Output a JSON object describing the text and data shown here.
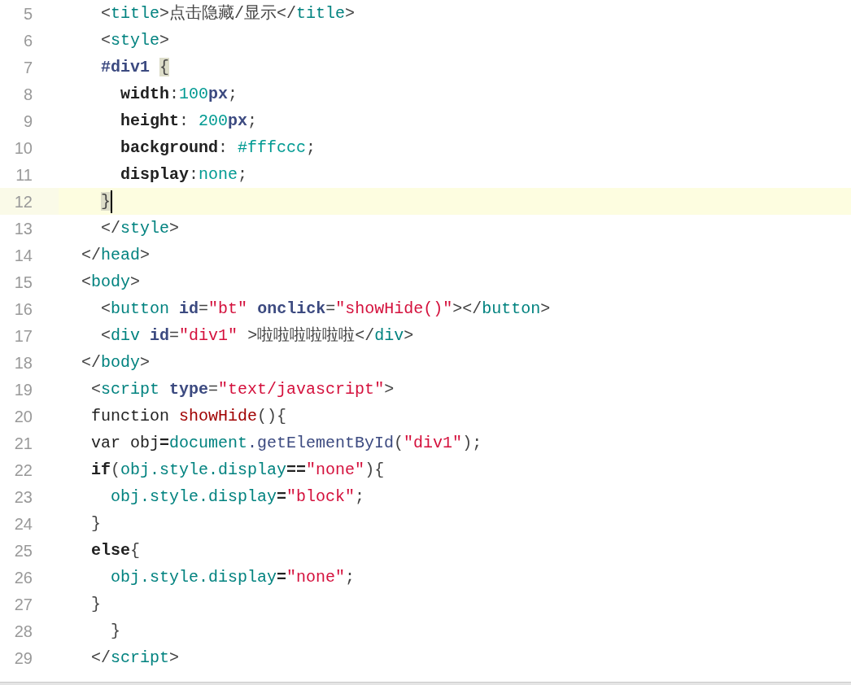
{
  "editor": {
    "lines": [
      {
        "number": "5",
        "current": false,
        "tokens": [
          {
            "text": "      <",
            "kind": "punct"
          },
          {
            "text": "title",
            "kind": "tag"
          },
          {
            "text": ">点击隐藏/显示</",
            "kind": "punct"
          },
          {
            "text": "title",
            "kind": "tag"
          },
          {
            "text": ">",
            "kind": "punct"
          }
        ]
      },
      {
        "number": "6",
        "current": false,
        "tokens": [
          {
            "text": "      <",
            "kind": "punct"
          },
          {
            "text": "style",
            "kind": "tag"
          },
          {
            "text": ">",
            "kind": "punct"
          }
        ]
      },
      {
        "number": "7",
        "current": false,
        "tokens": [
          {
            "text": "      #div1 ",
            "kind": "selector"
          },
          {
            "text": "{",
            "kind": "brace-match"
          }
        ]
      },
      {
        "number": "8",
        "current": false,
        "tokens": [
          {
            "text": "        width",
            "kind": "property"
          },
          {
            "text": ":",
            "kind": "punct"
          },
          {
            "text": "100",
            "kind": "number"
          },
          {
            "text": "px",
            "kind": "unit"
          },
          {
            "text": ";",
            "kind": "punct"
          }
        ]
      },
      {
        "number": "9",
        "current": false,
        "tokens": [
          {
            "text": "        height",
            "kind": "property"
          },
          {
            "text": ": ",
            "kind": "punct"
          },
          {
            "text": "200",
            "kind": "number"
          },
          {
            "text": "px",
            "kind": "unit"
          },
          {
            "text": ";",
            "kind": "punct"
          }
        ]
      },
      {
        "number": "10",
        "current": false,
        "tokens": [
          {
            "text": "        background",
            "kind": "property"
          },
          {
            "text": ": ",
            "kind": "punct"
          },
          {
            "text": "#fffccc",
            "kind": "number"
          },
          {
            "text": ";",
            "kind": "punct"
          }
        ]
      },
      {
        "number": "11",
        "current": false,
        "tokens": [
          {
            "text": "        display",
            "kind": "property"
          },
          {
            "text": ":",
            "kind": "punct"
          },
          {
            "text": "none",
            "kind": "number"
          },
          {
            "text": ";",
            "kind": "punct"
          }
        ]
      },
      {
        "number": "12",
        "current": true,
        "tokens": [
          {
            "text": "      }",
            "kind": "brace-match"
          }
        ]
      },
      {
        "number": "13",
        "current": false,
        "tokens": [
          {
            "text": "      </",
            "kind": "punct"
          },
          {
            "text": "style",
            "kind": "tag"
          },
          {
            "text": ">",
            "kind": "punct"
          }
        ]
      },
      {
        "number": "14",
        "current": false,
        "tokens": [
          {
            "text": "    </",
            "kind": "punct"
          },
          {
            "text": "head",
            "kind": "tag"
          },
          {
            "text": ">",
            "kind": "punct"
          }
        ]
      },
      {
        "number": "15",
        "current": false,
        "tokens": [
          {
            "text": "    <",
            "kind": "punct"
          },
          {
            "text": "body",
            "kind": "tag"
          },
          {
            "text": ">",
            "kind": "punct"
          }
        ]
      },
      {
        "number": "16",
        "current": false,
        "tokens": [
          {
            "text": "      <",
            "kind": "punct"
          },
          {
            "text": "button ",
            "kind": "tag"
          },
          {
            "text": "id",
            "kind": "attr"
          },
          {
            "text": "=",
            "kind": "punct"
          },
          {
            "text": "\"bt\" ",
            "kind": "string"
          },
          {
            "text": "onclick",
            "kind": "attr"
          },
          {
            "text": "=",
            "kind": "punct"
          },
          {
            "text": "\"showHide()\"",
            "kind": "string"
          },
          {
            "text": "></",
            "kind": "punct"
          },
          {
            "text": "button",
            "kind": "tag"
          },
          {
            "text": ">",
            "kind": "punct"
          }
        ]
      },
      {
        "number": "17",
        "current": false,
        "tokens": [
          {
            "text": "      <",
            "kind": "punct"
          },
          {
            "text": "div ",
            "kind": "tag"
          },
          {
            "text": "id",
            "kind": "attr"
          },
          {
            "text": "=",
            "kind": "punct"
          },
          {
            "text": "\"div1\"",
            "kind": "string"
          },
          {
            "text": " >啦啦啦啦啦啦</",
            "kind": "punct"
          },
          {
            "text": "div",
            "kind": "tag"
          },
          {
            "text": ">",
            "kind": "punct"
          }
        ]
      },
      {
        "number": "18",
        "current": false,
        "tokens": [
          {
            "text": "    </",
            "kind": "punct"
          },
          {
            "text": "body",
            "kind": "tag"
          },
          {
            "text": ">",
            "kind": "punct"
          }
        ]
      },
      {
        "number": "19",
        "current": false,
        "tokens": [
          {
            "text": "     <",
            "kind": "punct"
          },
          {
            "text": "script ",
            "kind": "tag"
          },
          {
            "text": "type",
            "kind": "attr"
          },
          {
            "text": "=",
            "kind": "punct"
          },
          {
            "text": "\"text/javascript\"",
            "kind": "string"
          },
          {
            "text": ">",
            "kind": "punct"
          }
        ]
      },
      {
        "number": "20",
        "current": false,
        "tokens": [
          {
            "text": "     function ",
            "kind": "plain"
          },
          {
            "text": "showHide",
            "kind": "funcname"
          },
          {
            "text": "(){",
            "kind": "punct"
          }
        ]
      },
      {
        "number": "21",
        "current": false,
        "tokens": [
          {
            "text": "     var obj",
            "kind": "plain"
          },
          {
            "text": "=",
            "kind": "keyword"
          },
          {
            "text": "document",
            "kind": "tag"
          },
          {
            "text": ".getElementById",
            "kind": "attr-light"
          },
          {
            "text": "(",
            "kind": "punct"
          },
          {
            "text": "\"div1\"",
            "kind": "string"
          },
          {
            "text": ");",
            "kind": "punct"
          }
        ]
      },
      {
        "number": "22",
        "current": false,
        "tokens": [
          {
            "text": "     if",
            "kind": "keyword"
          },
          {
            "text": "(",
            "kind": "punct"
          },
          {
            "text": "obj.style.display",
            "kind": "tag"
          },
          {
            "text": "==",
            "kind": "keyword"
          },
          {
            "text": "\"none\"",
            "kind": "string"
          },
          {
            "text": "){",
            "kind": "punct"
          }
        ]
      },
      {
        "number": "23",
        "current": false,
        "tokens": [
          {
            "text": "       obj.style.display",
            "kind": "tag"
          },
          {
            "text": "=",
            "kind": "keyword"
          },
          {
            "text": "\"block\"",
            "kind": "string"
          },
          {
            "text": ";",
            "kind": "punct"
          }
        ]
      },
      {
        "number": "24",
        "current": false,
        "tokens": [
          {
            "text": "     }",
            "kind": "punct"
          }
        ]
      },
      {
        "number": "25",
        "current": false,
        "tokens": [
          {
            "text": "     else",
            "kind": "keyword"
          },
          {
            "text": "{",
            "kind": "punct"
          }
        ]
      },
      {
        "number": "26",
        "current": false,
        "tokens": [
          {
            "text": "       obj.style.display",
            "kind": "tag"
          },
          {
            "text": "=",
            "kind": "keyword"
          },
          {
            "text": "\"none\"",
            "kind": "string"
          },
          {
            "text": ";",
            "kind": "punct"
          }
        ]
      },
      {
        "number": "27",
        "current": false,
        "tokens": [
          {
            "text": "     }",
            "kind": "punct"
          }
        ]
      },
      {
        "number": "28",
        "current": false,
        "tokens": [
          {
            "text": "       }",
            "kind": "punct"
          }
        ]
      },
      {
        "number": "29",
        "current": false,
        "tokens": [
          {
            "text": "     </",
            "kind": "punct"
          },
          {
            "text": "script",
            "kind": "tag"
          },
          {
            "text": ">",
            "kind": "punct"
          }
        ]
      }
    ]
  }
}
